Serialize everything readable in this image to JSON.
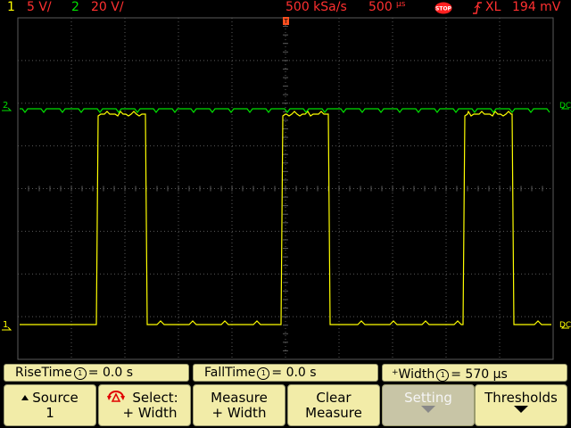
{
  "status": {
    "ch1_num": "1",
    "ch1_scale": "5 V/",
    "ch2_num": "2",
    "ch2_scale": "20 V/",
    "sample_rate": "500 kSa/s",
    "timebase_value": "500",
    "timebase_unit": "µs",
    "run_state": "STOP",
    "trigger_mode": "XL",
    "trigger_level": "194 mV"
  },
  "scope": {
    "ch1_marker": "1",
    "ch2_marker": "2",
    "ch2_coupling": "DC",
    "ch1_coupling": "DC",
    "colors": {
      "ch1": "#ffff00",
      "ch2": "#00e000",
      "grid": "#5a5a5a",
      "red": "#ff3030"
    }
  },
  "measurements": {
    "rise": {
      "name": "RiseTime",
      "src": "1",
      "value": "= 0.0 s"
    },
    "fall": {
      "name": "FallTime",
      "src": "1",
      "value": "= 0.0 s"
    },
    "width": {
      "prefix": "+",
      "name": "Width",
      "src": "1",
      "value": "= 570 µs"
    }
  },
  "softkeys": {
    "source": {
      "l1": "Source",
      "l2": "1"
    },
    "select": {
      "l1": "Select:",
      "l2": "+ Width"
    },
    "measure": {
      "l1": "Measure",
      "l2": "+ Width"
    },
    "clear": {
      "l1": "Clear",
      "l2": "Measure"
    },
    "setting": {
      "l1": "Setting"
    },
    "thresholds": {
      "l1": "Thresholds"
    }
  }
}
